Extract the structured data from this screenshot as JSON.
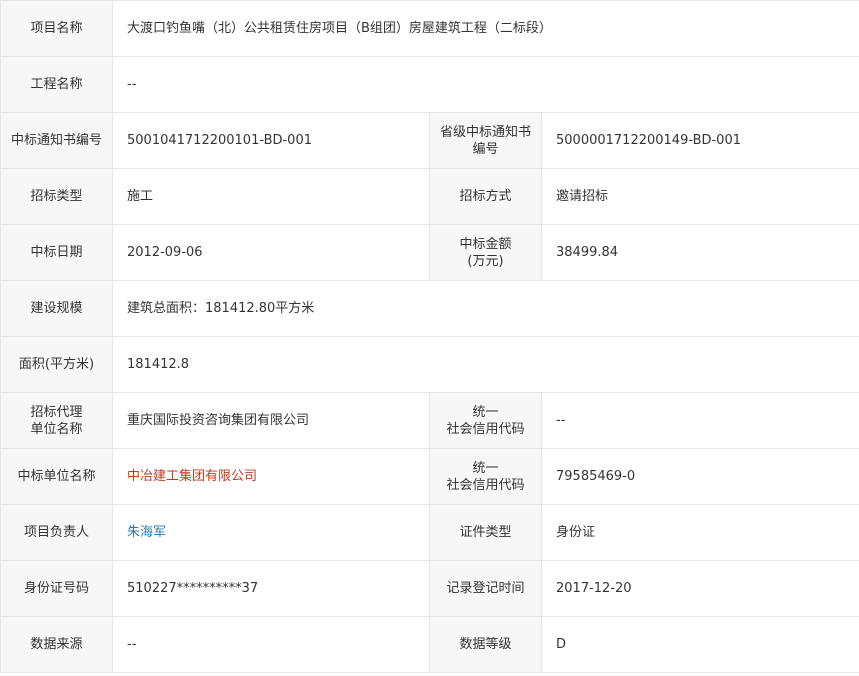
{
  "rows": {
    "project_name": {
      "label": "项目名称",
      "value": "大渡口钓鱼嘴（北）公共租赁住房项目（B组团）房屋建筑工程（二标段）"
    },
    "engineering_name": {
      "label": "工程名称",
      "value": "--"
    },
    "bid_notice_no": {
      "label": "中标通知书编号",
      "value": "5001041712200101-BD-001"
    },
    "prov_bid_notice_no": {
      "label": "省级中标通知书\n编号",
      "value": "5000001712200149-BD-001"
    },
    "tender_type": {
      "label": "招标类型",
      "value": "施工"
    },
    "tender_method": {
      "label": "招标方式",
      "value": "邀请招标"
    },
    "bid_date": {
      "label": "中标日期",
      "value": "2012-09-06"
    },
    "bid_amount": {
      "label": "中标金额\n(万元)",
      "value": "38499.84"
    },
    "construction_scale": {
      "label": "建设规模",
      "value": "建筑总面积：181412.80平方米"
    },
    "area": {
      "label": "面积(平方米)",
      "value": "181412.8"
    },
    "agency": {
      "label": "招标代理\n单位名称",
      "value": "重庆国际投资咨询集团有限公司"
    },
    "agency_credit_code": {
      "label": "统一\n社会信用代码",
      "value": "--"
    },
    "winner": {
      "label": "中标单位名称",
      "value": "中冶建工集团有限公司"
    },
    "winner_credit_code": {
      "label": "统一\n社会信用代码",
      "value": "79585469-0"
    },
    "project_manager": {
      "label": "项目负责人",
      "value": "朱海军"
    },
    "id_type": {
      "label": "证件类型",
      "value": "身份证"
    },
    "id_number": {
      "label": "身份证号码",
      "value": "510227**********37"
    },
    "record_time": {
      "label": "记录登记时间",
      "value": "2017-12-20"
    },
    "data_source": {
      "label": "数据来源",
      "value": "--"
    },
    "data_level": {
      "label": "数据等级",
      "value": "D"
    }
  },
  "colors": {
    "winner_link": "#c0391b",
    "person_link": "#2a7ab8",
    "label_bg": "#f7f7f7",
    "border": "#e6e6e6"
  }
}
